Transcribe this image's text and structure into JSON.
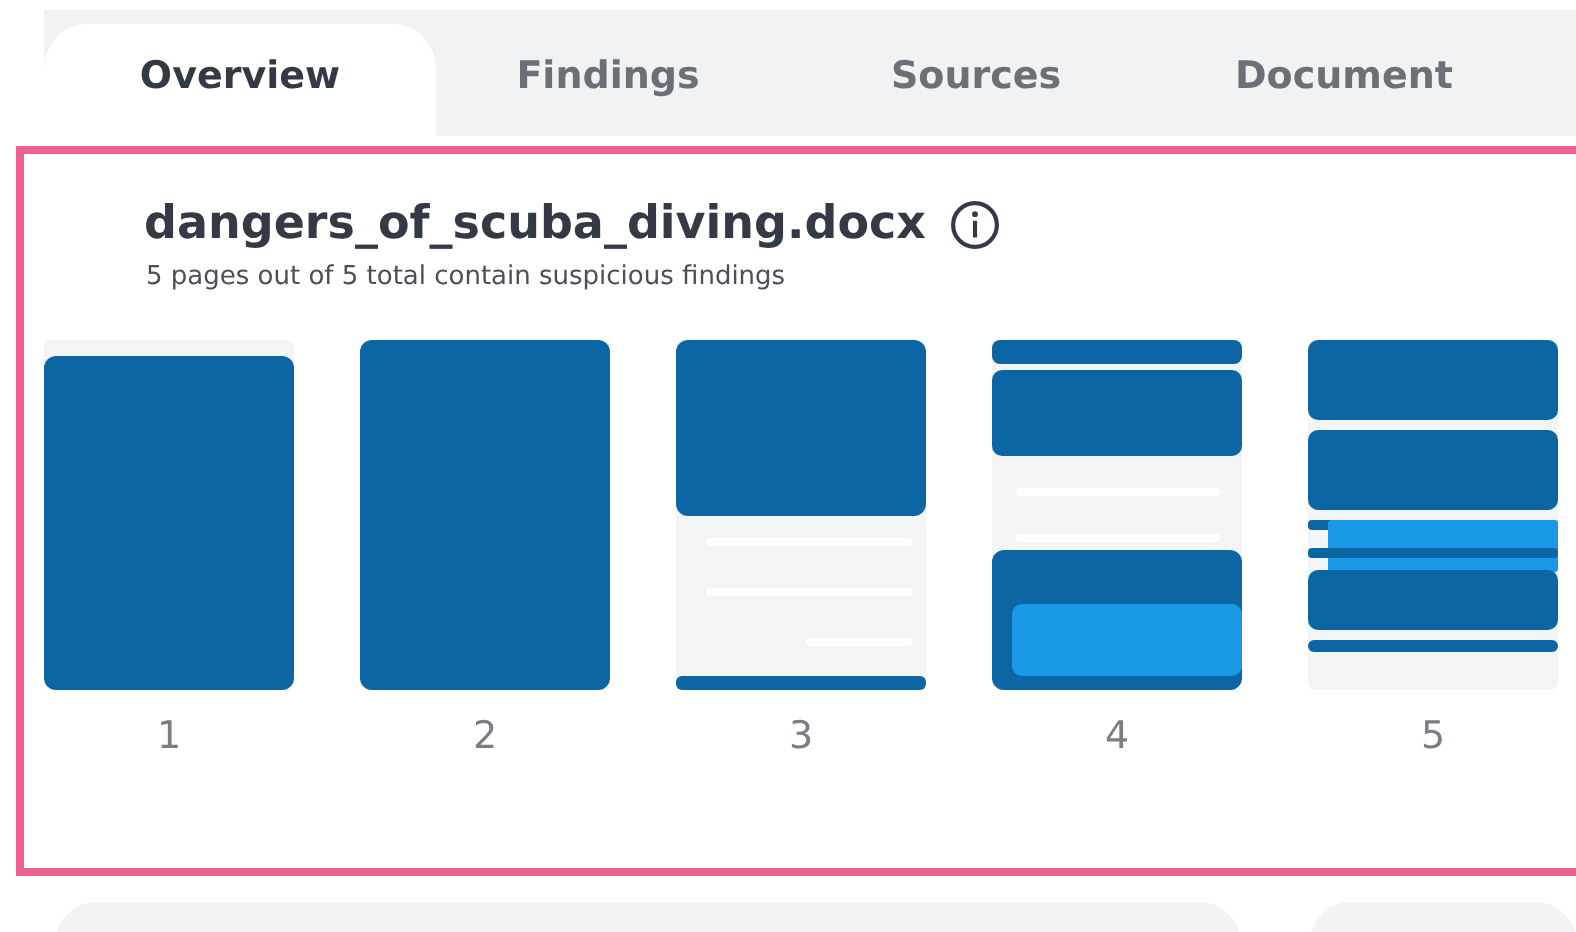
{
  "tabs": [
    {
      "label": "Overview",
      "selected": true
    },
    {
      "label": "Findings",
      "selected": false
    },
    {
      "label": "Sources",
      "selected": false
    },
    {
      "label": "Document",
      "selected": false
    }
  ],
  "document": {
    "title": "dangers_of_scuba_diving.docx",
    "summary": "5 pages out of 5 total contain suspicious findings"
  },
  "pages": [
    {
      "label": "1"
    },
    {
      "label": "2"
    },
    {
      "label": "3"
    },
    {
      "label": "4"
    },
    {
      "label": "5"
    }
  ]
}
